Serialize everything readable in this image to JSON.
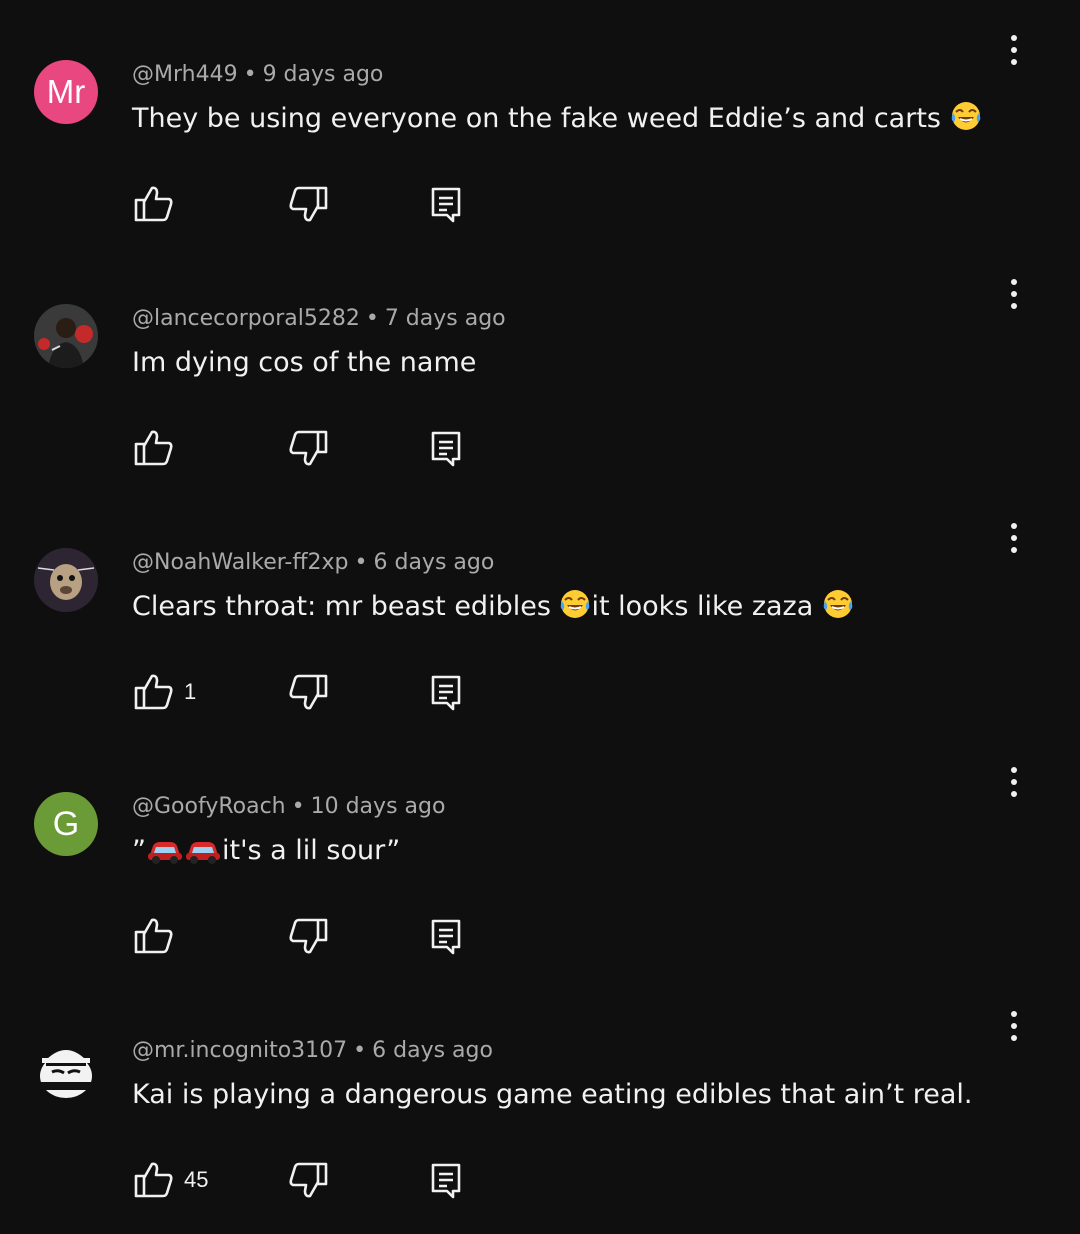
{
  "comments": [
    {
      "avatar_text": "Mr",
      "avatar_color": "#e8477f",
      "handle": "@Mrh449",
      "time": "9 days ago",
      "text": "They be using everyone on the fake weed Eddie’s and carts",
      "emoji_suffix": "face-with-tears-of-joy",
      "likes": ""
    },
    {
      "avatar_text": "",
      "handle": "@lancecorporal5282",
      "time": "7 days ago",
      "text": "Im dying cos of the name",
      "likes": ""
    },
    {
      "avatar_text": "",
      "handle": "@NoahWalker-ff2xp",
      "time": "6 days ago",
      "text_part1": "Clears throat: mr beast edibles ",
      "text_part2": "it looks like zaza ",
      "emoji": "face-with-tears-of-joy",
      "likes": "1"
    },
    {
      "avatar_text": "G",
      "avatar_color": "#6b9b37",
      "handle": "@GoofyRoach",
      "time": "10 days ago",
      "text_open": "”",
      "text_body": "it's a lil sour”",
      "emoji": "red-car",
      "likes": ""
    },
    {
      "avatar_text": "",
      "handle": "@mr.incognito3107",
      "time": "6 days ago",
      "text": "Kai is playing a dangerous game eating edibles that ain’t real.",
      "likes": "45"
    }
  ],
  "separator": "•",
  "colors": {
    "background": "#0f0f0f",
    "primary_text": "#f1f1f1",
    "secondary_text": "#aaaaaa"
  },
  "icons": [
    "thumbs-up-icon",
    "thumbs-down-icon",
    "reply-icon",
    "more-vert-icon"
  ]
}
